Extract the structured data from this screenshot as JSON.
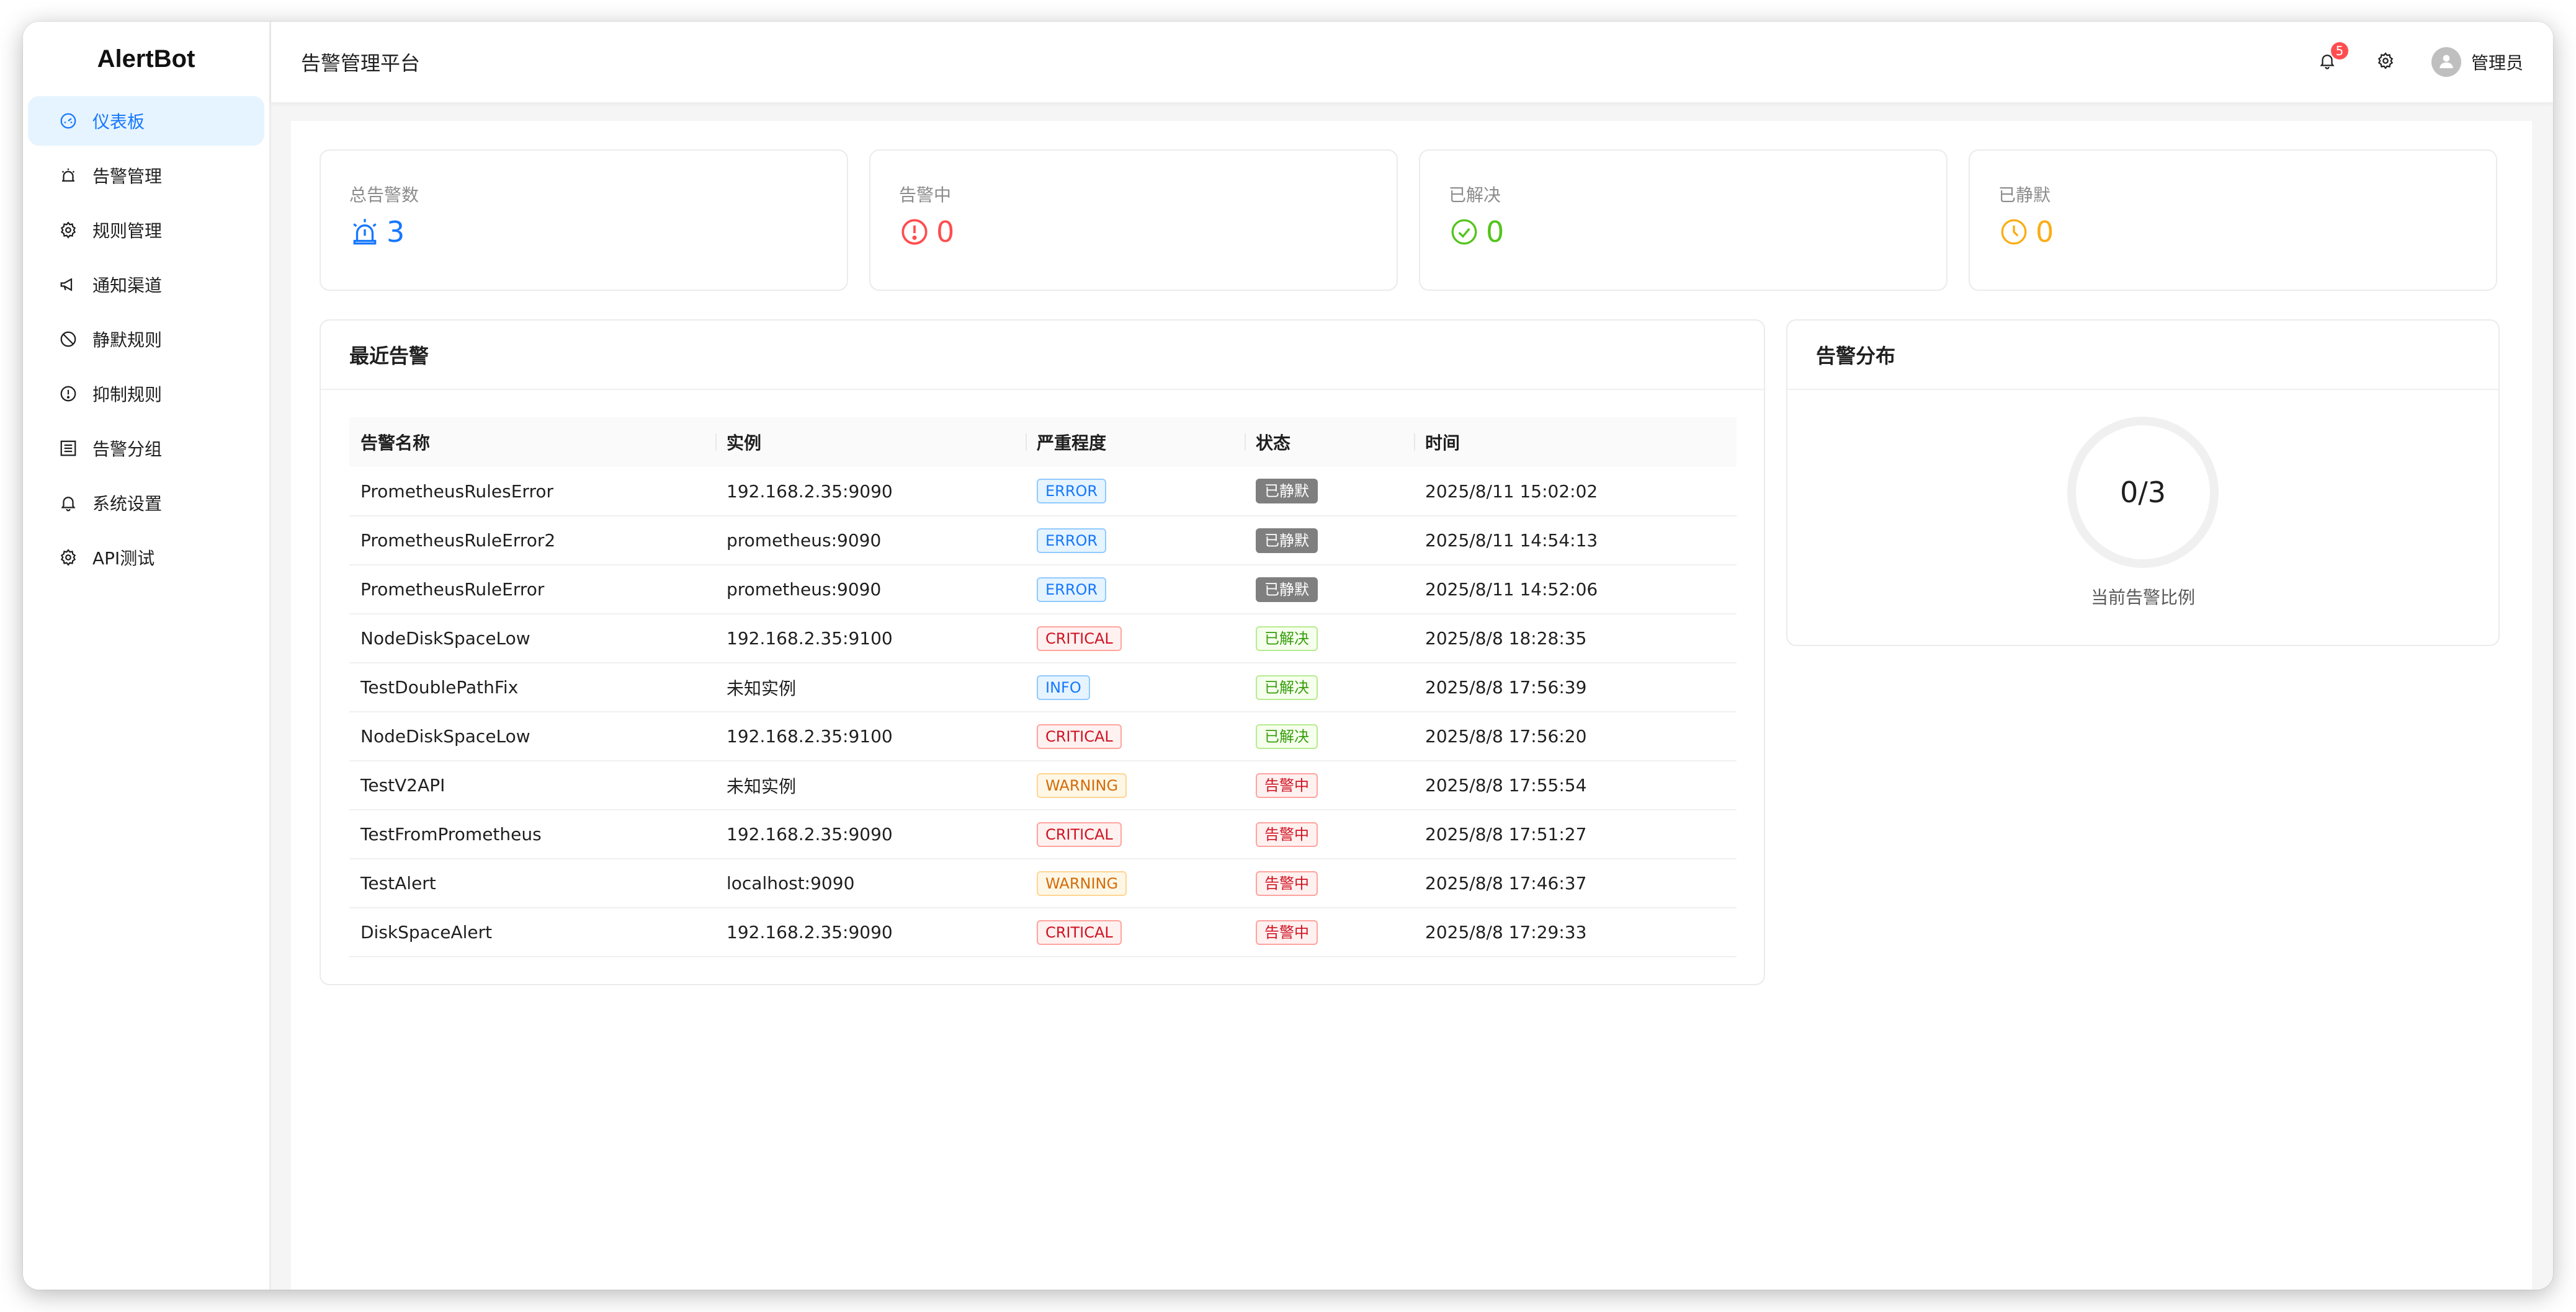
{
  "app": {
    "logo": "AlertBot",
    "header_title": "告警管理平台"
  },
  "sidebar": {
    "items": [
      {
        "label": "仪表板",
        "icon": "dashboard-icon",
        "active": true
      },
      {
        "label": "告警管理",
        "icon": "alert-icon"
      },
      {
        "label": "规则管理",
        "icon": "gear-icon"
      },
      {
        "label": "通知渠道",
        "icon": "megaphone-icon"
      },
      {
        "label": "静默规则",
        "icon": "stop-icon"
      },
      {
        "label": "抑制规则",
        "icon": "exclamation-circle-icon"
      },
      {
        "label": "告警分组",
        "icon": "group-icon"
      },
      {
        "label": "系统设置",
        "icon": "bell-icon"
      },
      {
        "label": "API测试",
        "icon": "gear-icon"
      }
    ]
  },
  "header": {
    "notification_count": "5",
    "user_name": "管理员"
  },
  "stats": [
    {
      "label": "总告警数",
      "value": "3",
      "icon": "alarm-icon",
      "color": "#1677ff"
    },
    {
      "label": "告警中",
      "value": "0",
      "icon": "exclamation-circle-icon",
      "color": "#ff4d4f"
    },
    {
      "label": "已解决",
      "value": "0",
      "icon": "check-circle-icon",
      "color": "#52c41a"
    },
    {
      "label": "已静默",
      "value": "0",
      "icon": "clock-icon",
      "color": "#faad14"
    }
  ],
  "recent": {
    "title": "最近告警",
    "columns": [
      "告警名称",
      "实例",
      "严重程度",
      "状态",
      "时间"
    ],
    "rows": [
      {
        "name": "PrometheusRulesError",
        "instance": "192.168.2.35:9090",
        "severity": "ERROR",
        "status": "已静默",
        "status_kind": "silenced",
        "time": "2025/8/11 15:02:02"
      },
      {
        "name": "PrometheusRuleError2",
        "instance": "prometheus:9090",
        "severity": "ERROR",
        "status": "已静默",
        "status_kind": "silenced",
        "time": "2025/8/11 14:54:13"
      },
      {
        "name": "PrometheusRuleError",
        "instance": "prometheus:9090",
        "severity": "ERROR",
        "status": "已静默",
        "status_kind": "silenced",
        "time": "2025/8/11 14:52:06"
      },
      {
        "name": "NodeDiskSpaceLow",
        "instance": "192.168.2.35:9100",
        "severity": "CRITICAL",
        "status": "已解决",
        "status_kind": "resolved",
        "time": "2025/8/8 18:28:35"
      },
      {
        "name": "TestDoublePathFix",
        "instance": "未知实例",
        "severity": "INFO",
        "status": "已解决",
        "status_kind": "resolved",
        "time": "2025/8/8 17:56:39"
      },
      {
        "name": "NodeDiskSpaceLow",
        "instance": "192.168.2.35:9100",
        "severity": "CRITICAL",
        "status": "已解决",
        "status_kind": "resolved",
        "time": "2025/8/8 17:56:20"
      },
      {
        "name": "TestV2API",
        "instance": "未知实例",
        "severity": "WARNING",
        "status": "告警中",
        "status_kind": "firing",
        "time": "2025/8/8 17:55:54"
      },
      {
        "name": "TestFromPrometheus",
        "instance": "192.168.2.35:9090",
        "severity": "CRITICAL",
        "status": "告警中",
        "status_kind": "firing",
        "time": "2025/8/8 17:51:27"
      },
      {
        "name": "TestAlert",
        "instance": "localhost:9090",
        "severity": "WARNING",
        "status": "告警中",
        "status_kind": "firing",
        "time": "2025/8/8 17:46:37"
      },
      {
        "name": "DiskSpaceAlert",
        "instance": "192.168.2.35:9090",
        "severity": "CRITICAL",
        "status": "告警中",
        "status_kind": "firing",
        "time": "2025/8/8 17:29:33"
      }
    ]
  },
  "distribution": {
    "title": "告警分布",
    "ratio": "0/3",
    "caption": "当前告警比例"
  }
}
